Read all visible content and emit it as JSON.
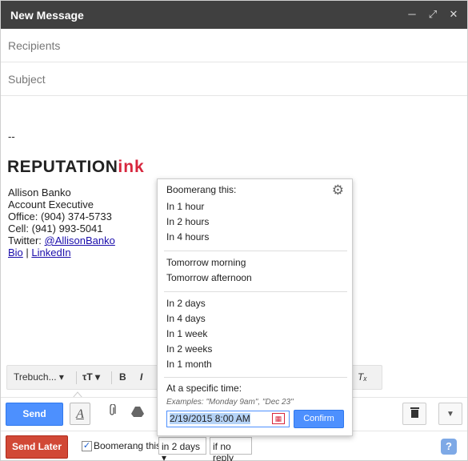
{
  "window": {
    "title": "New Message"
  },
  "fields": {
    "recipients_placeholder": "Recipients",
    "subject_placeholder": "Subject"
  },
  "signature": {
    "dash": "--",
    "logo_rep": "REPUTATION",
    "logo_ink": "ink",
    "name": "Allison Banko",
    "role": "Account Executive",
    "office": "Office: (904) 374-5733",
    "cell": "Cell: (941) 993-5041",
    "twitter_prefix": "Twitter: ",
    "twitter_handle": "@AllisonBanko",
    "bio": "Bio",
    "separator": " | ",
    "linkedin": "LinkedIn"
  },
  "toolbar": {
    "font": "Trebuch...",
    "send": "Send",
    "send_later": "Send Later",
    "boomerang_label": "Boomerang this",
    "delay_select": "in 2 days",
    "condition_select": "if no reply",
    "help": "?"
  },
  "boomerang_menu": {
    "heading": "Boomerang this:",
    "group1": [
      "In 1 hour",
      "In 2 hours",
      "In 4 hours"
    ],
    "group2": [
      "Tomorrow morning",
      "Tomorrow afternoon"
    ],
    "group3": [
      "In 2 days",
      "In 4 days",
      "In 1 week",
      "In 2 weeks",
      "In 1 month"
    ],
    "specific_label": "At a specific time:",
    "examples": "Examples: \"Monday 9am\", \"Dec 23\"",
    "datetime_value": "2/19/2015 8:00 AM",
    "confirm": "Confirm"
  },
  "colors": {
    "accent_blue": "#4d90fe",
    "send_later_red": "#d14836",
    "title_bar": "#404040",
    "logo_red": "#d7263d"
  }
}
